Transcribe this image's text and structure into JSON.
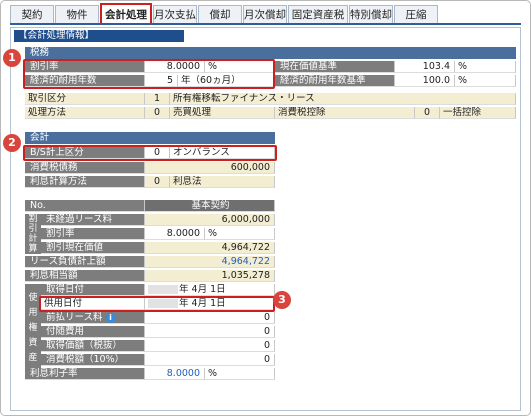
{
  "tabs": [
    "契約",
    "物件",
    "会計処理",
    "月次支払",
    "償却",
    "月次償却",
    "固定資産税",
    "特別償却",
    "圧縮"
  ],
  "section_title": "【会計処理情報】",
  "tax": {
    "header": "税務",
    "discount_rate_label": "割引率",
    "discount_rate_value": "8.0000",
    "discount_rate_unit": "%",
    "pv_label": "現在価値基準",
    "pv_value": "103.4",
    "pv_unit": "%",
    "useful_life_label": "経済的耐用年数",
    "useful_life_value": "5",
    "useful_life_unit": "年（60ヵ月）",
    "useful_life_std_label": "経済的耐用年数基準",
    "useful_life_std_value": "100.0",
    "useful_life_std_unit": "%",
    "trade_class_label": "取引区分",
    "trade_class_code": "1",
    "trade_class_value": "所有権移転ファイナンス・リース",
    "method_label": "処理方法",
    "method_code": "0",
    "method_value": "売買処理",
    "tax_deduct_label": "消費税控除",
    "tax_deduct_code": "0",
    "tax_deduct_value": "一括控除"
  },
  "accounting": {
    "header": "会計",
    "bs_label": "B/S計上区分",
    "bs_code": "0",
    "bs_value": "オンバランス",
    "consumption_tax_label": "消費税債務",
    "consumption_tax_value": "600,000",
    "interest_method_label": "利息計算方法",
    "interest_method_code": "0",
    "interest_method_value": "利息法"
  },
  "table": {
    "no_label": "No.",
    "col_label": "基本契約",
    "side_discount": [
      "割",
      "引",
      "計",
      "算"
    ],
    "side_use": [
      "使",
      "用",
      "権",
      "資",
      "産"
    ],
    "unpaid_label": "未経過リース料",
    "unpaid_value": "6,000,000",
    "rate_label": "割引率",
    "rate_value": "8.0000",
    "rate_unit": "%",
    "pv_label": "割引現在価値",
    "pv_value": "4,964,722",
    "liability_label": "リース負債計上額",
    "liability_value": "4,964,722",
    "interest_label": "利息相当額",
    "interest_value": "1,035,278",
    "acquire_label": "取得日付",
    "acquire_value": "年  4月  1日",
    "use_date_label": "供用日付",
    "use_date_value": "年  4月  1日",
    "prepaid_label": "前払リース料",
    "prepaid_value": "0",
    "incidental_label": "付随費用",
    "incidental_value": "0",
    "cost_label": "取得価額（税抜）",
    "cost_value": "0",
    "vat_label": "消費税額（10%）",
    "vat_value": "0",
    "interest_rate_label": "利息利子率",
    "interest_rate_value": "8.0000",
    "interest_rate_unit": "%"
  },
  "badges": [
    "1",
    "2",
    "3"
  ]
}
